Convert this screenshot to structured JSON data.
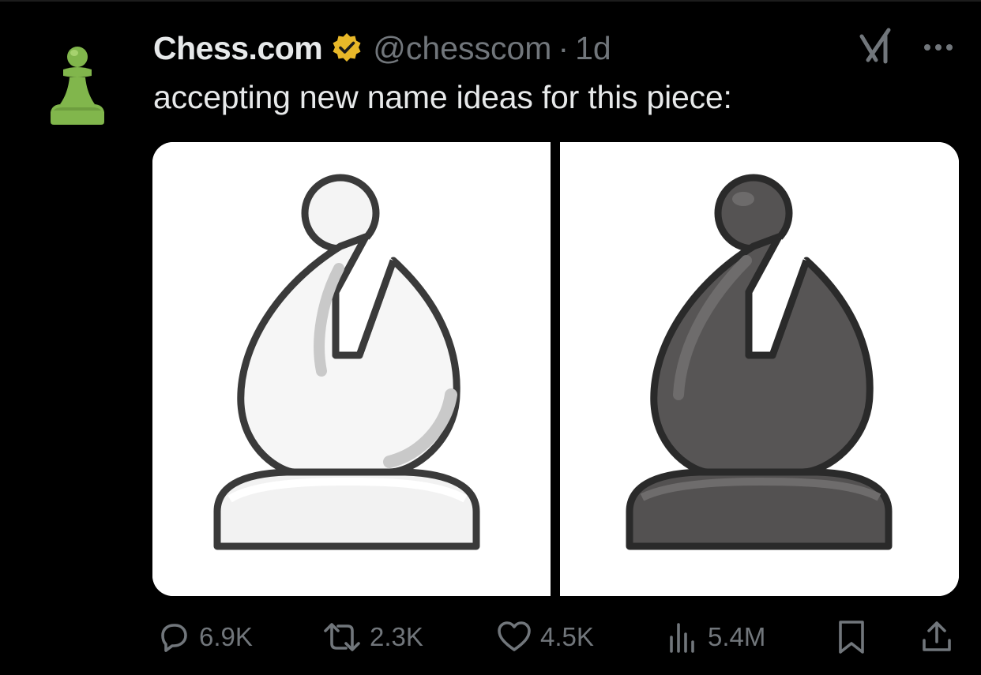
{
  "tweet": {
    "author_name": "Chess.com",
    "handle": "@chesscom",
    "separator": "·",
    "time": "1d",
    "text": "accepting new name ideas for this piece:"
  },
  "icons": {
    "avatar": "green-pawn-icon",
    "verified": "gold-verified-badge-icon",
    "grok": "grok-icon",
    "more": "more-dots-icon",
    "reply": "reply-icon",
    "retweet": "retweet-icon",
    "like": "heart-icon",
    "views": "views-bar-icon",
    "bookmark": "bookmark-icon",
    "share": "share-icon"
  },
  "media": {
    "left_image": "white-bishop-piece",
    "right_image": "black-bishop-piece"
  },
  "actions": {
    "replies": "6.9K",
    "retweets": "2.3K",
    "likes": "4.5K",
    "views": "5.4M"
  },
  "colors": {
    "background": "#000000",
    "text_primary": "#e7e9ea",
    "text_secondary": "#71767b",
    "verified_gold": "#e8b829",
    "pawn_green": "#81b64c"
  }
}
